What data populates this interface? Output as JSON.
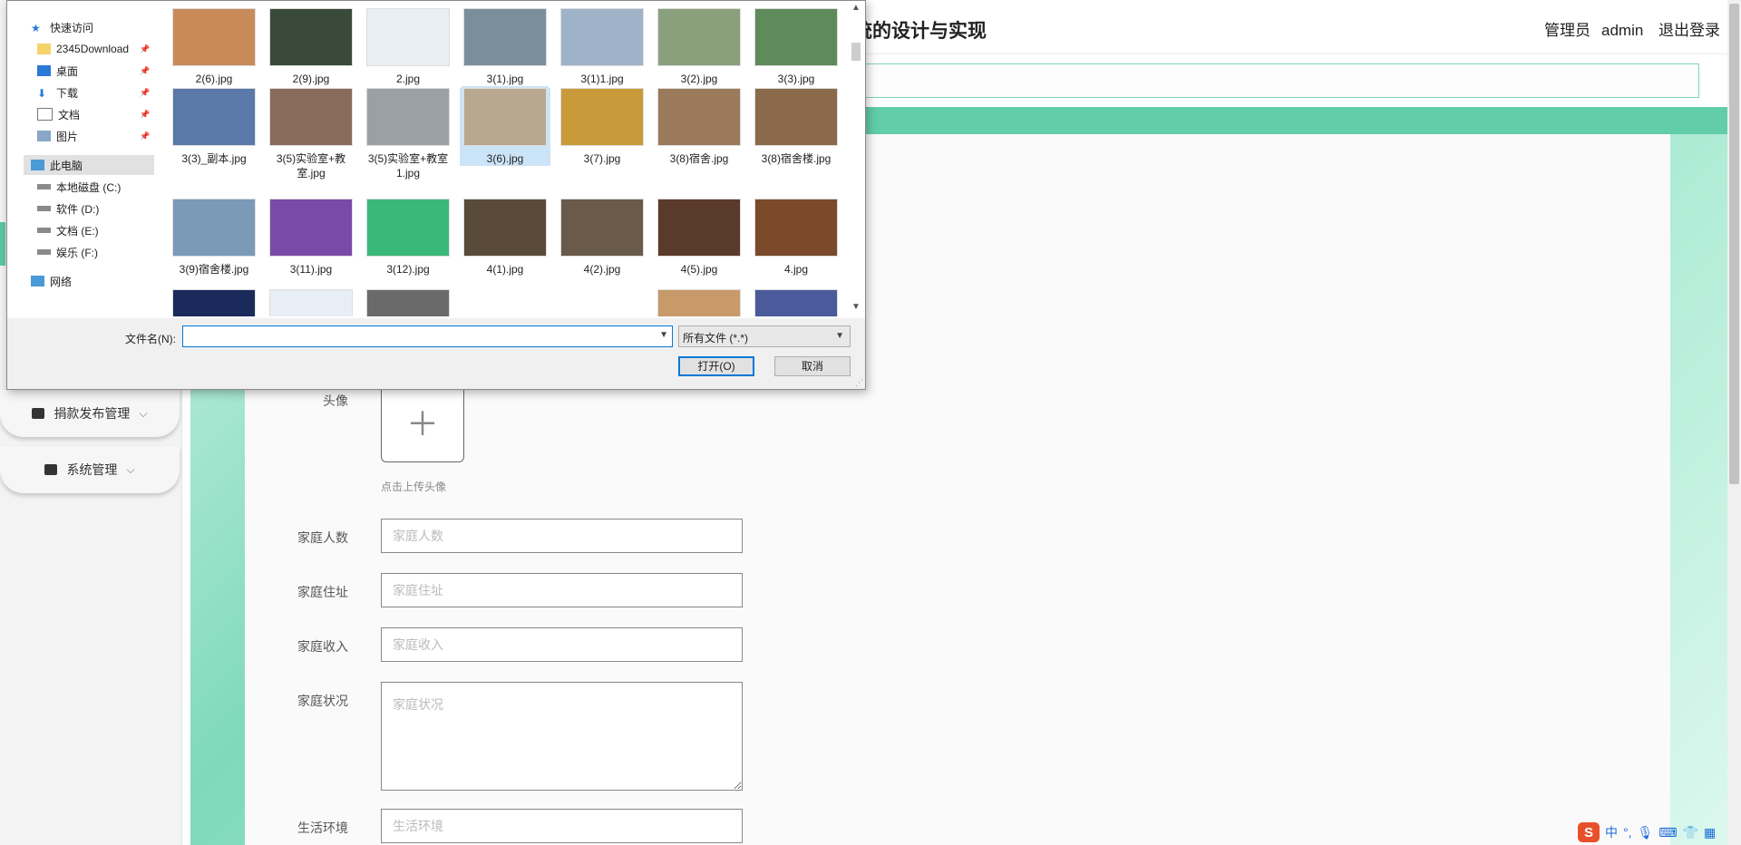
{
  "app": {
    "title": "贫困地区儿童资助系统的设计与实现",
    "user_role": "管理员",
    "username": "admin",
    "logout_label": "退出登录"
  },
  "sidebar": {
    "items": [
      {
        "label": "捐款发布管理",
        "icon": "comment-icon"
      },
      {
        "label": "系统管理",
        "icon": "monitor-icon"
      }
    ]
  },
  "form": {
    "avatar_label": "头像",
    "avatar_hint": "点击上传头像",
    "fields": [
      {
        "label": "家庭人数",
        "placeholder": "家庭人数"
      },
      {
        "label": "家庭住址",
        "placeholder": "家庭住址"
      },
      {
        "label": "家庭收入",
        "placeholder": "家庭收入"
      },
      {
        "label": "家庭状况",
        "placeholder": "家庭状况"
      },
      {
        "label": "生活环境",
        "placeholder": "生活环境"
      }
    ]
  },
  "dialog": {
    "nav": [
      {
        "label": "快速访问",
        "icon": "star-icon"
      },
      {
        "label": "2345Download",
        "icon": "folder-icon",
        "pinned": true
      },
      {
        "label": "桌面",
        "icon": "desktop-icon",
        "pinned": true
      },
      {
        "label": "下载",
        "icon": "download-icon",
        "pinned": true
      },
      {
        "label": "文档",
        "icon": "document-icon",
        "pinned": true
      },
      {
        "label": "图片",
        "icon": "picture-icon",
        "pinned": true
      },
      {
        "label": "此电脑",
        "icon": "computer-icon",
        "selected": true
      },
      {
        "label": "本地磁盘 (C:)",
        "icon": "drive-icon"
      },
      {
        "label": "软件 (D:)",
        "icon": "drive-icon"
      },
      {
        "label": "文档 (E:)",
        "icon": "drive-icon"
      },
      {
        "label": "娱乐 (F:)",
        "icon": "drive-icon"
      },
      {
        "label": "网络",
        "icon": "network-icon"
      }
    ],
    "files": [
      {
        "name": "2(6).jpg",
        "color": "#c98a5a"
      },
      {
        "name": "2(9).jpg",
        "color": "#3a4a3a"
      },
      {
        "name": "2.jpg",
        "color": "#e9eef2"
      },
      {
        "name": "3(1).jpg",
        "color": "#7a8f9c"
      },
      {
        "name": "3(1)1.jpg",
        "color": "#9fb3c8"
      },
      {
        "name": "3(2).jpg",
        "color": "#8aa07c"
      },
      {
        "name": "3(3).jpg",
        "color": "#5f8a5a"
      },
      {
        "name": "3(3)_副本.jpg",
        "color": "#5a78a8"
      },
      {
        "name": "3(5)实验室+教室.jpg",
        "color": "#8a6a5a"
      },
      {
        "name": "3(5)实验室+教室1.jpg",
        "color": "#9aa0a6"
      },
      {
        "name": "3(6).jpg",
        "color": "#b8a890",
        "selected": true
      },
      {
        "name": "3(7).jpg",
        "color": "#c89a3a"
      },
      {
        "name": "3(8)宿舍.jpg",
        "color": "#9a7a5a"
      },
      {
        "name": "3(8)宿舍楼.jpg",
        "color": "#8a6a4a"
      },
      {
        "name": "3(9)宿舍楼.jpg",
        "color": "#7a9ab8"
      },
      {
        "name": "3(11).jpg",
        "color": "#7a4aa8"
      },
      {
        "name": "3(12).jpg",
        "color": "#3ab87a"
      },
      {
        "name": "4(1).jpg",
        "color": "#5a4a3a"
      },
      {
        "name": "4(2).jpg",
        "color": "#6a5a4a"
      },
      {
        "name": "4(5).jpg",
        "color": "#5a3a2a"
      },
      {
        "name": "4.jpg",
        "color": "#7a4a2a"
      }
    ],
    "filename_label": "文件名(N):",
    "filename_value": "",
    "filetype": "所有文件 (*.*)",
    "open_label": "打开(O)",
    "cancel_label": "取消"
  },
  "ime": {
    "mode": "中"
  }
}
